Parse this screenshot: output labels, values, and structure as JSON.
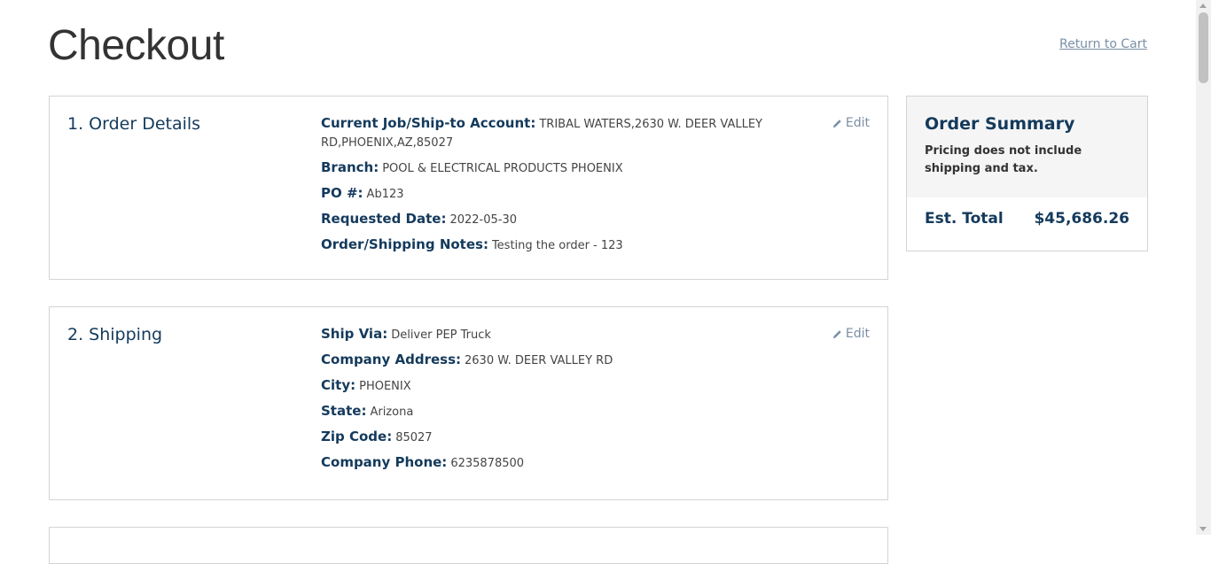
{
  "page": {
    "title": "Checkout",
    "return_link": "Return to Cart"
  },
  "order_details": {
    "heading": "1. Order Details",
    "edit_label": "Edit",
    "fields": [
      {
        "label": "Current Job/Ship-to Account:",
        "value": "TRIBAL WATERS,2630 W. DEER VALLEY RD,PHOENIX,AZ,85027"
      },
      {
        "label": "Branch:",
        "value": "POOL & ELECTRICAL PRODUCTS PHOENIX"
      },
      {
        "label": "PO #:",
        "value": "Ab123"
      },
      {
        "label": "Requested Date:",
        "value": "2022-05-30"
      },
      {
        "label": "Order/Shipping Notes:",
        "value": "Testing the order - 123"
      }
    ]
  },
  "shipping": {
    "heading": "2. Shipping",
    "edit_label": "Edit",
    "fields": [
      {
        "label": "Ship Via:",
        "value": "Deliver PEP Truck"
      },
      {
        "label": "Company Address:",
        "value": "2630 W. DEER VALLEY RD"
      },
      {
        "label": "City:",
        "value": "PHOENIX"
      },
      {
        "label": "State:",
        "value": "Arizona"
      },
      {
        "label": "Zip Code:",
        "value": "85027"
      },
      {
        "label": "Company Phone:",
        "value": "6235878500"
      }
    ]
  },
  "summary": {
    "title": "Order Summary",
    "note": "Pricing does not include shipping and tax.",
    "total_label": "Est. Total",
    "total_value": "$45,686.26"
  },
  "icons": {
    "edit": "pencil-icon"
  }
}
